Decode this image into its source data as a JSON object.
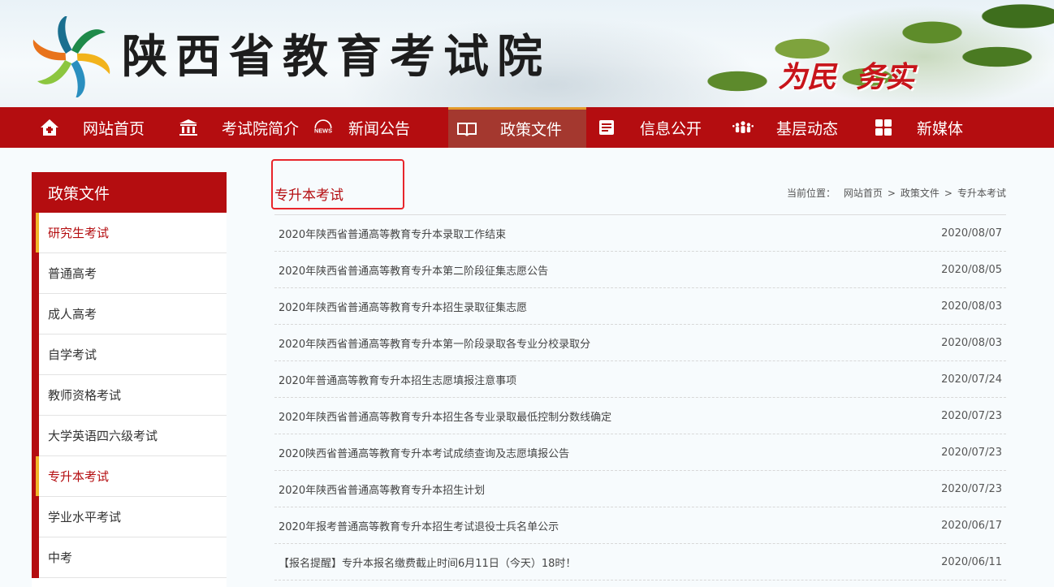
{
  "header": {
    "site_title": "陕西省教育考试院",
    "slogan_1": "为民",
    "slogan_2": "务实"
  },
  "nav": {
    "items": [
      {
        "label": "网站首页",
        "icon": "home-icon"
      },
      {
        "label": "考试院简介",
        "icon": "building-icon"
      },
      {
        "label": "新闻公告",
        "icon": "news-icon"
      },
      {
        "label": "政策文件",
        "icon": "book-icon",
        "active": true
      },
      {
        "label": "信息公开",
        "icon": "document-icon"
      },
      {
        "label": "基层动态",
        "icon": "people-icon"
      },
      {
        "label": "新媒体",
        "icon": "grid-icon"
      }
    ]
  },
  "sidebar": {
    "title": "政策文件",
    "items": [
      {
        "label": "研究生考试",
        "active": true
      },
      {
        "label": "普通高考"
      },
      {
        "label": "成人高考"
      },
      {
        "label": "自学考试"
      },
      {
        "label": "教师资格考试"
      },
      {
        "label": "大学英语四六级考试"
      },
      {
        "label": "专升本考试",
        "active": true
      },
      {
        "label": "学业水平考试"
      },
      {
        "label": "中考"
      }
    ]
  },
  "main": {
    "title": "专升本考试",
    "breadcrumb": {
      "prefix": "当前位置：",
      "items": [
        "网站首页",
        "政策文件",
        "专升本考试"
      ],
      "separator": ">"
    },
    "news": [
      {
        "title": "2020年陕西省普通高等教育专升本录取工作结束",
        "date": "2020/08/07"
      },
      {
        "title": "2020年陕西省普通高等教育专升本第二阶段征集志愿公告",
        "date": "2020/08/05"
      },
      {
        "title": "2020年陕西省普通高等教育专升本招生录取征集志愿",
        "date": "2020/08/03"
      },
      {
        "title": "2020年陕西省普通高等教育专升本第一阶段录取各专业分校录取分",
        "date": "2020/08/03"
      },
      {
        "title": "2020年普通高等教育专升本招生志愿填报注意事项",
        "date": "2020/07/24"
      },
      {
        "title": "2020年陕西省普通高等教育专升本招生各专业录取最低控制分数线确定",
        "date": "2020/07/23"
      },
      {
        "title": "2020陕西省普通高等教育专升本考试成绩查询及志愿填报公告",
        "date": "2020/07/23"
      },
      {
        "title": "2020年陕西省普通高等教育专升本招生计划",
        "date": "2020/07/23"
      },
      {
        "title": "2020年报考普通高等教育专升本招生考试退役士兵名单公示",
        "date": "2020/06/17"
      },
      {
        "title": "【报名提醒】专升本报名缴费截止时间6月11日（今天）18时！",
        "date": "2020/06/11"
      }
    ]
  },
  "colors": {
    "brand_red": "#b40d10",
    "active_nav": "#a4382f",
    "highlight_border": "#e8252b",
    "active_marker": "#f0b82a"
  }
}
